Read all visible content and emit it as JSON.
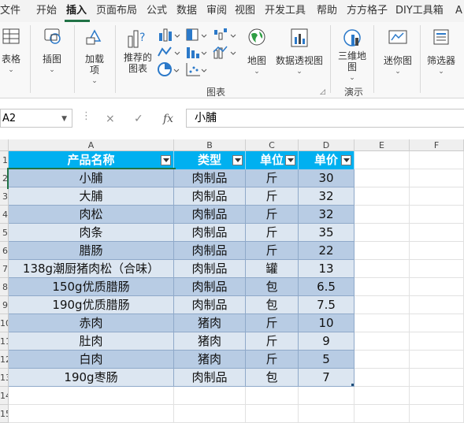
{
  "tabs": [
    {
      "label": "文件",
      "active": false
    },
    {
      "label": "开始",
      "active": false
    },
    {
      "label": "插入",
      "active": true
    },
    {
      "label": "页面布局",
      "active": false
    },
    {
      "label": "公式",
      "active": false
    },
    {
      "label": "数据",
      "active": false
    },
    {
      "label": "审阅",
      "active": false
    },
    {
      "label": "视图",
      "active": false
    },
    {
      "label": "开发工具",
      "active": false
    },
    {
      "label": "帮助",
      "active": false
    },
    {
      "label": "方方格子",
      "active": false
    },
    {
      "label": "DIY工具箱",
      "active": false
    },
    {
      "label": "A",
      "active": false
    }
  ],
  "ribbon": {
    "table_label_1": "表格",
    "picture_label": "插图",
    "addins_label_1": "加载",
    "addins_label_2": "项",
    "recommended_label_1": "推荐的",
    "recommended_label_2": "图表",
    "map_label": "地图",
    "pivotchart_label": "数据透视图",
    "map3d_label_1": "三维地",
    "map3d_label_2": "图",
    "sparkline_label": "迷你图",
    "filter_label": "筛选器",
    "group_charts": "图表",
    "group_tours": "演示",
    "colors": {
      "accent": "#217346"
    }
  },
  "formula_bar": {
    "name_box": "A2",
    "cancel_icon": "×",
    "enter_icon": "✓",
    "fx_label": "fx",
    "formula_value": "小脯"
  },
  "sheet": {
    "columns": [
      "A",
      "B",
      "C",
      "D",
      "E",
      "F"
    ],
    "row_numbers": [
      "1",
      "2",
      "3",
      "4",
      "5",
      "6",
      "7",
      "8",
      "9",
      "10",
      "11",
      "12",
      "13",
      "14",
      "15"
    ],
    "header": [
      "产品名称",
      "类型",
      "单位",
      "单价"
    ],
    "rows": [
      [
        "小脯",
        "肉制品",
        "斤",
        "30"
      ],
      [
        "大脯",
        "肉制品",
        "斤",
        "32"
      ],
      [
        "肉松",
        "肉制品",
        "斤",
        "32"
      ],
      [
        "肉条",
        "肉制品",
        "斤",
        "35"
      ],
      [
        "腊肠",
        "肉制品",
        "斤",
        "22"
      ],
      [
        "138g潮厨猪肉松（合味）",
        "肉制品",
        "罐",
        "13"
      ],
      [
        "150g优质腊肠",
        "肉制品",
        "包",
        "6.5"
      ],
      [
        "190g优质腊肠",
        "肉制品",
        "包",
        "7.5"
      ],
      [
        "赤肉",
        "猪肉",
        "斤",
        "10"
      ],
      [
        "肚肉",
        "猪肉",
        "斤",
        "9"
      ],
      [
        "白肉",
        "猪肉",
        "斤",
        "5"
      ],
      [
        "190g枣肠",
        "肉制品",
        "包",
        "7"
      ]
    ],
    "colors": {
      "header_bg": "#00b0f0",
      "band_dark": "#b8cce4",
      "band_light": "#dce6f1",
      "text": "#111111"
    }
  }
}
